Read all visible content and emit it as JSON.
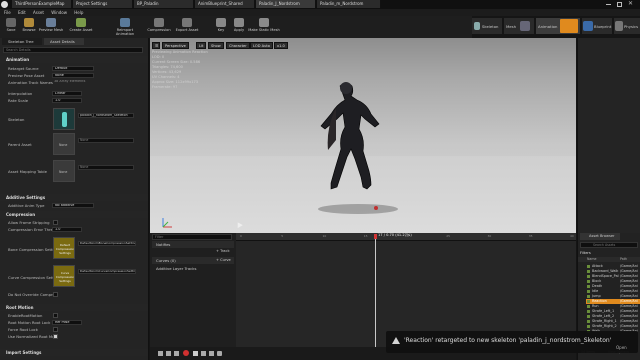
{
  "window": {
    "tabs": [
      "ThirdPersonExampleMap",
      "Project Settings",
      "BP_Paladin",
      "AnimBlueprint_Shared",
      "Paladin_J_Nordstrom",
      "Paladin_m_Nordstrom"
    ],
    "close_glyph": "✕"
  },
  "menu": [
    "File",
    "Edit",
    "Asset",
    "Window",
    "Help"
  ],
  "mode_tabs": {
    "skeleton": "Skeleton",
    "mesh": "Mesh",
    "animation": "Animation",
    "blueprint": "Blueprint",
    "physics": "Physics"
  },
  "toolbar": [
    "Save",
    "Browse",
    "Preview Mesh",
    "Create Asset",
    "Reimport Animation",
    "Compression",
    "Export Asset",
    "Key",
    "Apply",
    "Make Static Mesh"
  ],
  "left_panel": {
    "tabs": [
      "Skeleton Tree",
      "Asset Details"
    ],
    "search_placeholder": "Search Details",
    "sections": {
      "animation": "Animation",
      "additive": "Additive Settings",
      "compression": "Compression",
      "root_motion": "Root Motion",
      "import": "Import Settings"
    },
    "rows": {
      "retarget_source": {
        "label": "Retarget Source",
        "value": "Default"
      },
      "preview_pose_asset": {
        "label": "Preview Pose Asset",
        "value": "None"
      },
      "anim_track_names": {
        "label": "Animation Track Names",
        "value": "38 Array elements"
      },
      "interpolation": {
        "label": "Interpolation",
        "value": "Linear"
      },
      "rate_scale": {
        "label": "Rate Scale",
        "value": "1.0"
      },
      "skeleton": {
        "label": "Skeleton",
        "value": "paladin_j_nordstrom_Skeleton"
      },
      "parent_asset": {
        "label": "Parent Asset",
        "value": "None"
      },
      "asset_mapping_table": {
        "label": "Asset Mapping Table",
        "value": "None"
      },
      "additive_anim_type": {
        "label": "Additive Anim Type",
        "value": "No additive"
      },
      "allow_frame_stripping": {
        "label": "Allow Frame Stripping",
        "value": ""
      },
      "compression_error_thresh": {
        "label": "Compression Error Thres",
        "value": "1.0"
      },
      "bone_compression_settings": {
        "label": "Bone Compression Settings",
        "value": "DefaultAnimBoneCompressionSettings"
      },
      "curve_compression_settings": {
        "label": "Curve Compression Settin",
        "value": "DefaultAnimCurveCompressionSettings"
      },
      "do_not_override_compression": {
        "label": "Do Not Override Compres",
        "value": ""
      },
      "enable_root_motion": {
        "label": "EnableRootMotion",
        "value": ""
      },
      "root_motion_root_lock": {
        "label": "Root Motion Root Lock",
        "value": "Ref Pose"
      },
      "force_root_lock": {
        "label": "Force Root Lock",
        "value": ""
      },
      "use_normalized_root": {
        "label": "Use Normalized Root Moti",
        "value": ""
      }
    },
    "thumb_labels": {
      "parent": "None",
      "mapping": "None",
      "bone": "Default Compression Settings",
      "curve": "Curve Compression Settings"
    }
  },
  "viewport": {
    "buttons": [
      "Perspective",
      "Lit",
      "Show",
      "Character",
      "LOD Auto",
      "x1.0"
    ],
    "stats": [
      "Previewing Animation Reaction",
      "LOD: 0",
      "Current Screen Size: 0.586",
      "Triangles: 74,600",
      "Vertices: 43,629",
      "UV Channels: 4",
      "Approx Size: 112x99x173",
      "Framerate: 97"
    ]
  },
  "timeline": {
    "search_placeholder": "Filter",
    "notifies": "Notifies",
    "track_button": "+ Track",
    "curves": "Curves (0)",
    "curve_button": "+ Curve",
    "additive_layer": "Additive Layer Tracks",
    "playhead": "17 / 0.70 (41.27%)",
    "ruler": [
      "0",
      "5",
      "10",
      "15",
      "20",
      "25",
      "30",
      "35",
      "40"
    ]
  },
  "asset_browser": {
    "tab": "Asset Browser",
    "search_placeholder": "Search Assets",
    "filters": "Filters",
    "col_name": "Name",
    "col_path": "Path",
    "items": [
      {
        "name": "Attack",
        "path": "/Game/Ani"
      },
      {
        "name": "Backward_Walk",
        "path": "/Game/Ani"
      },
      {
        "name": "BlendSpace_Pal",
        "path": "/Game/Ani"
      },
      {
        "name": "Block",
        "path": "/Game/Ani"
      },
      {
        "name": "Death",
        "path": "/Game/Ani"
      },
      {
        "name": "Idle",
        "path": "/Game/Ani"
      },
      {
        "name": "Jump",
        "path": "/Game/Ani"
      },
      {
        "name": "Reaction",
        "path": "/Game/Ani"
      },
      {
        "name": "Run",
        "path": "/Game/Ani"
      },
      {
        "name": "Strafe_Left_1",
        "path": "/Game/Ani"
      },
      {
        "name": "Strafe_Left_2",
        "path": "/Game/Ani"
      },
      {
        "name": "Strafe_Right_1",
        "path": "/Game/Ani"
      },
      {
        "name": "Strafe_Right_2",
        "path": "/Game/Ani"
      },
      {
        "name": "Walk",
        "path": "/Game/Ani"
      }
    ],
    "selected_index": 7,
    "footer": "14 items",
    "view_options": "View Options"
  },
  "notification": {
    "text": "'Reaction' retargeted to new skeleton 'paladin_j_nordstrom_Skeleton'",
    "link": "Open"
  },
  "colors": {
    "accent": "#e08a1e",
    "panel": "#242424",
    "viewport_top": "#9a9a9a",
    "viewport_floor": "#c9c9c9"
  }
}
